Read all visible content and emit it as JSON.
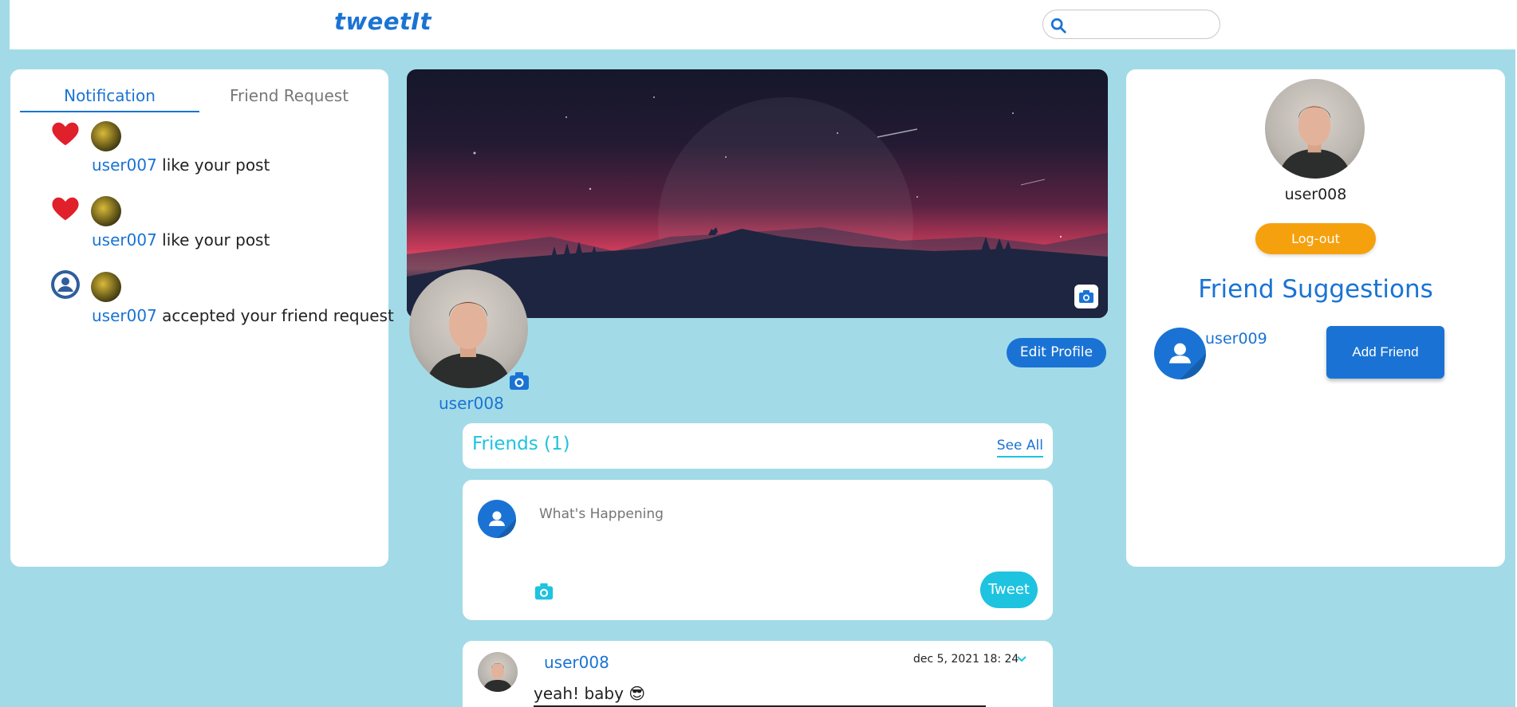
{
  "navbar": {
    "logo": "tweetIt",
    "search_placeholder": ""
  },
  "left_panel": {
    "tabs": [
      {
        "label": "Notification",
        "active": true
      },
      {
        "label": "Friend Request",
        "active": false
      }
    ],
    "notifications": [
      {
        "icon": "heart-icon",
        "user": "user007",
        "text": "like your post"
      },
      {
        "icon": "heart-icon",
        "user": "user007",
        "text": "like your post"
      },
      {
        "icon": "user-circle-icon",
        "user": "user007",
        "text": "accepted your friend request"
      }
    ]
  },
  "profile": {
    "username": "user008",
    "edit_label": "Edit Profile"
  },
  "friends": {
    "title": "Friends (1)",
    "see_all": "See All"
  },
  "composer": {
    "placeholder": "What's Happening",
    "tweet_label": "Tweet"
  },
  "post": {
    "user": "user008",
    "date": "dec 5, 2021 18: 24",
    "text": "yeah! baby 😎"
  },
  "right_panel": {
    "username": "user008",
    "logout_label": "Log-out",
    "suggestions_title": "Friend Suggestions",
    "suggestions": [
      {
        "user": "user009",
        "button": "Add Friend"
      }
    ]
  },
  "colors": {
    "background": "#a2dbe7",
    "primary": "#1a73d4",
    "accent": "#1ec3e0",
    "logout": "#f5a10e",
    "heart": "#e0202a"
  }
}
